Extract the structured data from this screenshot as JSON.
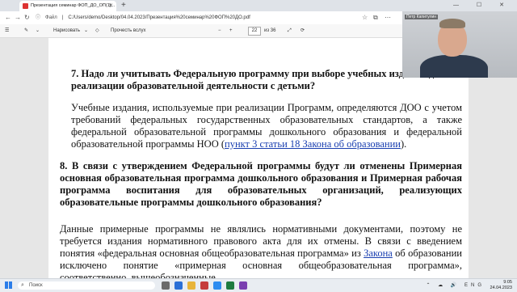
{
  "browser": {
    "tab_title": "Презентация семинар ФОП_ДО_ОП(1)...",
    "new_tab": "+",
    "window_controls": "— ☐ ✕",
    "address_label": "Файл",
    "url": "C:/Users/demo/Desktop/04.04.2023/Презентация%20семинар%20ФОП%20ДО.pdf"
  },
  "pdf_toolbar": {
    "draw_label": "Нарисовать",
    "read_aloud_label": "Прочесть вслух",
    "page_current": "22",
    "page_total": "из 36"
  },
  "document": {
    "q7_title": "7. Надо ли учитывать Федеральную программу при выборе учебных изданий для реализации образовательной деятельности с детьми?",
    "q7_body": "Учебные издания, используемые при реализации Программ, определяются ДОО с учетом требований федеральных государственных образовательных стандартов, а также федеральной образовательной программы дошкольного образования и федеральной образовательной программы НОО (",
    "q7_link": "пункт 3 статьи 18 Закона об образовании",
    "q7_end": ").",
    "q8_title": "8. В связи с утверждением Федеральной программы будут ли отменены Примерная основная образовательная программа дошкольного образования и Примерная рабочая программа воспитания для образовательных организаций, реализующих образовательные программы дошкольного образования?",
    "q8_body_1": "Данные примерные программы не являлись нормативными документами, поэтому не требуется издания нормативного правового акта для их отмены. В связи с введением понятия «федеральная основная общеобразовательная программа» из ",
    "q8_link": "Закона",
    "q8_body_2": " об образовании исключено понятие «примерная основная общеобразовательная программа», соответственно, вышеобозначенные"
  },
  "video": {
    "participant_name": "Петр Капитулин"
  },
  "taskbar": {
    "search_placeholder": "Поиск",
    "lang": "ENG",
    "time": "9:05",
    "date": "24.04.2023"
  }
}
